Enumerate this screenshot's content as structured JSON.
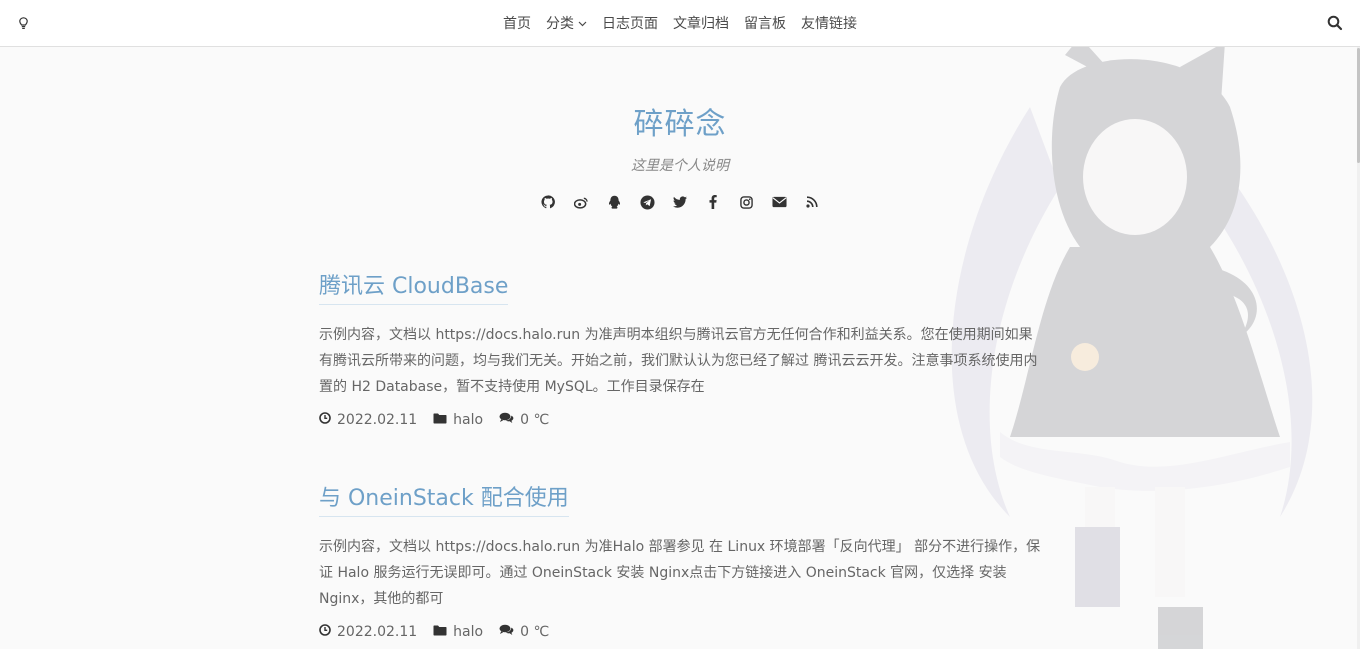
{
  "nav": {
    "items": [
      {
        "label": "首页"
      },
      {
        "label": "分类",
        "has_dropdown": true
      },
      {
        "label": "日志页面"
      },
      {
        "label": "文章归档"
      },
      {
        "label": "留言板"
      },
      {
        "label": "友情链接"
      }
    ],
    "theme_icon": "lightbulb-icon",
    "search_icon": "search-icon"
  },
  "hero": {
    "title": "碎碎念",
    "description": "这里是个人说明",
    "social_icons": [
      "github-icon",
      "weibo-icon",
      "qq-icon",
      "telegram-icon",
      "twitter-icon",
      "facebook-icon",
      "instagram-icon",
      "email-icon",
      "rss-icon"
    ]
  },
  "posts": [
    {
      "title": "腾讯云 CloudBase",
      "excerpt": "示例内容，文档以 https://docs.halo.run 为准声明本组织与腾讯云官方无任何合作和利益关系。您在使用期间如果有腾讯云所带来的问题，均与我们无关。开始之前，我们默认认为您已经了解过 腾讯云云开发。注意事项系统使用内置的 H2 Database，暂不支持使用 MySQL。工作目录保存在",
      "date": "2022.02.11",
      "category": "halo",
      "comments": "0 ℃"
    },
    {
      "title": "与 OneinStack 配合使用",
      "excerpt": "示例内容，文档以 https://docs.halo.run 为准Halo 部署参见 在 Linux 环境部署「反向代理」 部分不进行操作，保证 Halo 服务运行无误即可。通过 OneinStack 安装 Nginx点击下方链接进入 OneinStack 官网，仅选择 安装 Nginx，其他的都可",
      "date": "2022.02.11",
      "category": "halo",
      "comments": "0 ℃"
    }
  ],
  "colors": {
    "accent": "#6ea0c8",
    "text": "#666666",
    "background": "#fafafa"
  }
}
